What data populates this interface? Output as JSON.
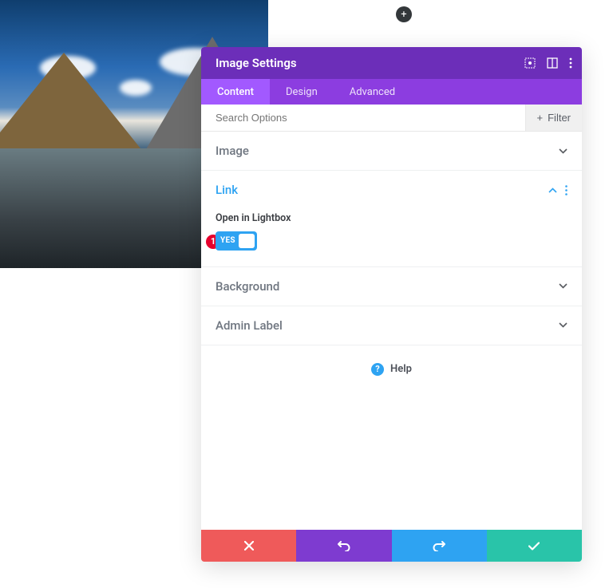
{
  "add_button": "+",
  "panel": {
    "title": "Image Settings",
    "tabs": {
      "content": "Content",
      "design": "Design",
      "advanced": "Advanced"
    },
    "search": {
      "placeholder": "Search Options",
      "filter_label": "Filter"
    },
    "sections": {
      "image": {
        "title": "Image"
      },
      "link": {
        "title": "Link",
        "open_lightbox_label": "Open in Lightbox",
        "toggle_text": "YES",
        "badge": "1"
      },
      "background": {
        "title": "Background"
      },
      "admin_label": {
        "title": "Admin Label"
      }
    },
    "help": "Help"
  }
}
